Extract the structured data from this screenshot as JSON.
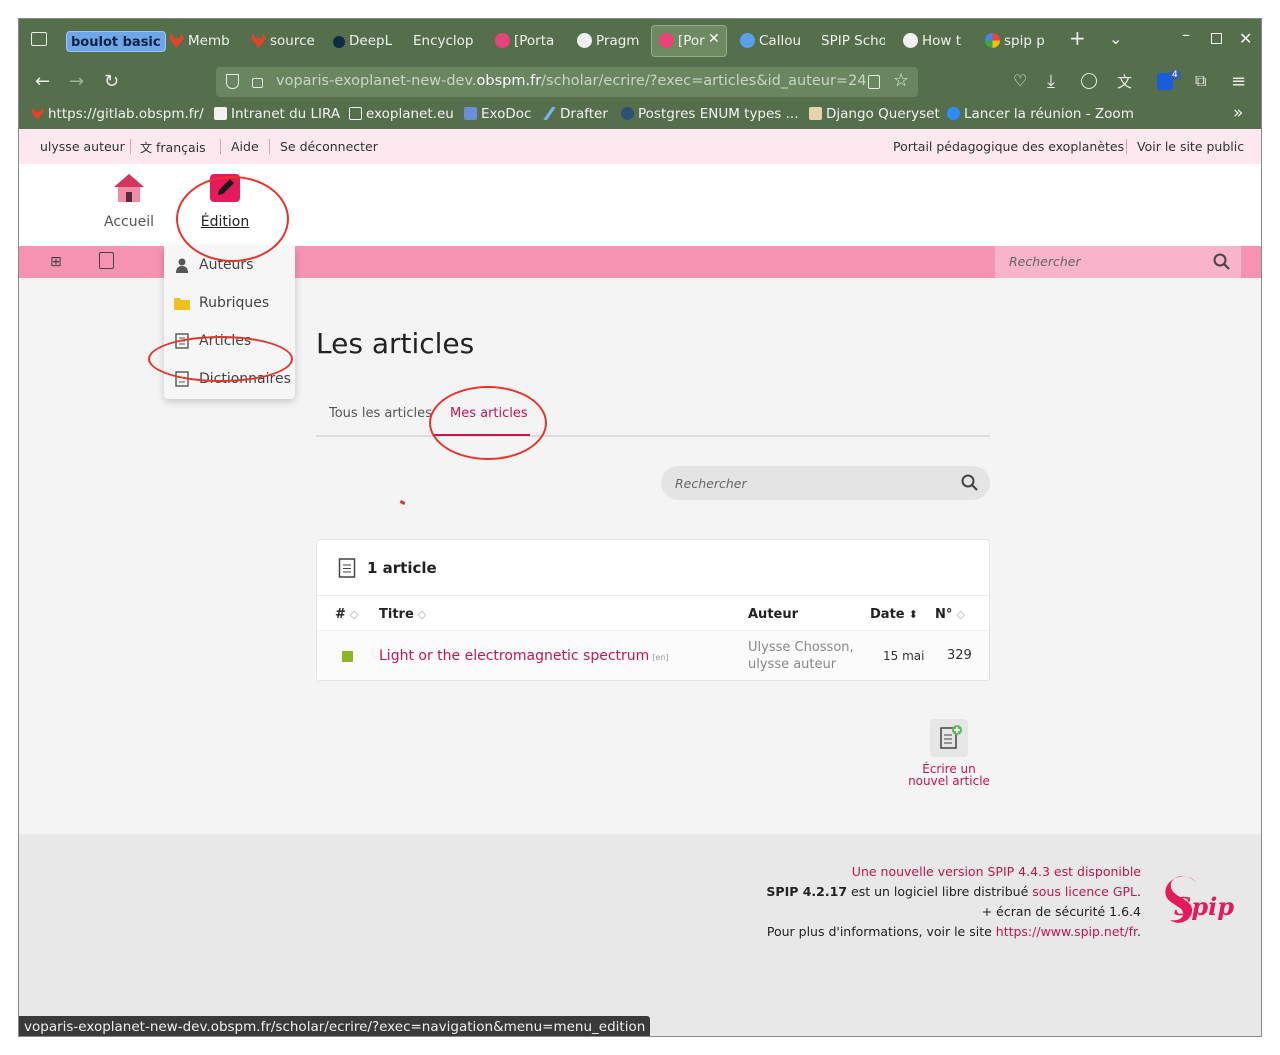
{
  "browser": {
    "tab_group": "boulot basic",
    "tabs": [
      {
        "label": "Memb",
        "icon": "gitlab-icon"
      },
      {
        "label": "source",
        "icon": "gitlab-icon"
      },
      {
        "label": "DeepL",
        "icon": "deepl-icon"
      },
      {
        "label": "Encyclop",
        "icon": ""
      },
      {
        "label": "[Porta",
        "icon": "spip-icon"
      },
      {
        "label": "Pragm",
        "icon": "github-icon"
      },
      {
        "label": "[Por",
        "icon": "spip-icon"
      },
      {
        "label": "Callou",
        "icon": "globe-icon"
      },
      {
        "label": "SPIP Scho",
        "icon": ""
      },
      {
        "label": "How t",
        "icon": "github-icon"
      },
      {
        "label": "spip p",
        "icon": "google-icon"
      }
    ],
    "url_prefix": "voparis-exoplanet-new-dev.",
    "url_domain": "obspm.fr",
    "url_path": "/scholar/ecrire/?exec=articles&id_auteur=24",
    "extension_badge": "4",
    "bookmarks": [
      {
        "label": "https://gitlab.obspm.fr/",
        "icon": "gitlab-icon"
      },
      {
        "label": "Intranet du LIRA",
        "icon": "page-icon"
      },
      {
        "label": "exoplanet.eu",
        "icon": "folder-icon"
      },
      {
        "label": "ExoDoc",
        "icon": "doc-icon"
      },
      {
        "label": "Drafter",
        "icon": "drafter-icon"
      },
      {
        "label": "Postgres ENUM types ...",
        "icon": "elephant-icon"
      },
      {
        "label": "Django Queryset",
        "icon": "django-icon"
      },
      {
        "label": "Lancer la réunion - Zoom",
        "icon": "zoom-icon"
      }
    ],
    "status_url": "voparis-exoplanet-new-dev.obspm.fr/scholar/ecrire/?exec=navigation&menu=menu_edition"
  },
  "spip": {
    "topbar": {
      "user": "ulysse auteur",
      "lang": "français",
      "help": "Aide",
      "logout": "Se déconnecter",
      "portal": "Portail pédagogique des exoplanètes",
      "public": "Voir le site public"
    },
    "nav": {
      "home": "Accueil",
      "edition": "Édition"
    },
    "submenu": [
      "Auteurs",
      "Rubriques",
      "Articles",
      "Dictionnaires"
    ],
    "search_placeholder": "Rechercher",
    "page_title": "Les articles",
    "tabs": {
      "all": "Tous les articles",
      "mine": "Mes articles"
    },
    "table": {
      "count_label": "1 article",
      "headers": {
        "num": "#",
        "title": "Titre",
        "author": "Auteur",
        "date": "Date",
        "id": "N°"
      },
      "rows": [
        {
          "title": "Light or the electromagnetic spectrum",
          "lang": "[en]",
          "author_line1": "Ulysse Chosson,",
          "author_line2": "ulysse auteur",
          "date": "15 mai",
          "id": "329",
          "status_color": "#8db624"
        }
      ]
    },
    "new_article": {
      "line1": "Écrire un",
      "line2": "nouvel article"
    },
    "footer": {
      "update_notice": "Une nouvelle version SPIP 4.4.3 est disponible",
      "version": "SPIP 4.2.17",
      "free_software": " est un logiciel libre distribué ",
      "license": "sous licence GPL",
      "security": "+ écran de sécurité 1.6.4",
      "more_info": "Pour plus d'informations, voir le site ",
      "site_url": "https://www.spip.net/fr",
      "logo_text": "Spip"
    },
    "accent": "#c4174f",
    "pink": "#f693b3"
  }
}
